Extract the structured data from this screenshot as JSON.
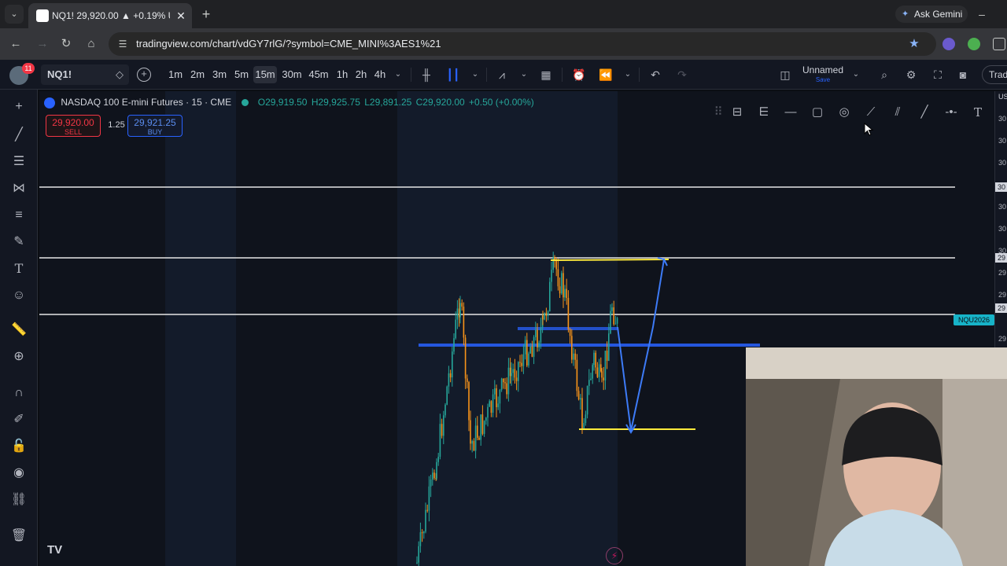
{
  "browser": {
    "tab_title": "NQ1! 29,920.00 ▲ +0.19% Unn",
    "tab_close": "✕",
    "new_tab": "+",
    "gemini_label": "Ask Gemini",
    "url": "tradingview.com/chart/vdGY7rlG/?symbol=CME_MINI%3AES1%21"
  },
  "toolbar": {
    "notification_count": "11",
    "symbol": "NQ1!",
    "timeframes": [
      "1m",
      "2m",
      "3m",
      "5m",
      "15m",
      "30m",
      "45m",
      "1h",
      "2h",
      "4h"
    ],
    "active_timeframe": "15m",
    "layout_name": "Unnamed",
    "layout_save": "Save",
    "trade_label": "Trad"
  },
  "legend": {
    "title": "NASDAQ 100 E-mini Futures · 15 · CME",
    "open": "O29,919.50",
    "high": "H29,925.75",
    "low": "L29,891.25",
    "close": "C29,920.00",
    "change": "+0.50 (+0.00%)"
  },
  "trade": {
    "sell_price": "29,920.00",
    "sell_label": "SELL",
    "spread": "1.25",
    "buy_price": "29,921.25",
    "buy_label": "BUY"
  },
  "price_axis": {
    "labels": [
      "30",
      "30",
      "30",
      "30",
      "30",
      "30",
      "30",
      "29",
      "29",
      "29",
      "29",
      "29",
      "29",
      "29",
      "29",
      "29",
      "29",
      "29",
      "29",
      "29",
      "29",
      "29"
    ],
    "highlighted": [
      "30",
      "29",
      "29"
    ],
    "contract_tag": "NQU2026",
    "currency": "US"
  },
  "colors": {
    "bull": "#26a69a",
    "bear": "#f7931a",
    "accent": "#2962ff",
    "level_yellow": "#ffeb3b",
    "zone_blue": "#2962ff",
    "path_blue": "#3d7bf7",
    "sell_red": "#f23645"
  },
  "icons": {
    "left_toolbar": [
      "crosshair-icon",
      "trendline-icon",
      "horizontal-lines-icon",
      "pattern-icon",
      "fib-icon",
      "brush-icon",
      "text-icon",
      "emoji-icon",
      "ruler-icon",
      "zoom-icon",
      "magnet-icon",
      "pencil-lock-icon",
      "lock-icon",
      "eye-icon",
      "link-icon",
      "trash-icon"
    ],
    "draw_toolbar": [
      "fib-retracement-icon",
      "pitchfork-icon",
      "horizontal-line-icon",
      "rectangle-icon",
      "circle-icon",
      "ray-icon",
      "parallel-channel-icon",
      "trend-line-icon",
      "horizontal-ray-icon",
      "text-tool-icon"
    ]
  }
}
